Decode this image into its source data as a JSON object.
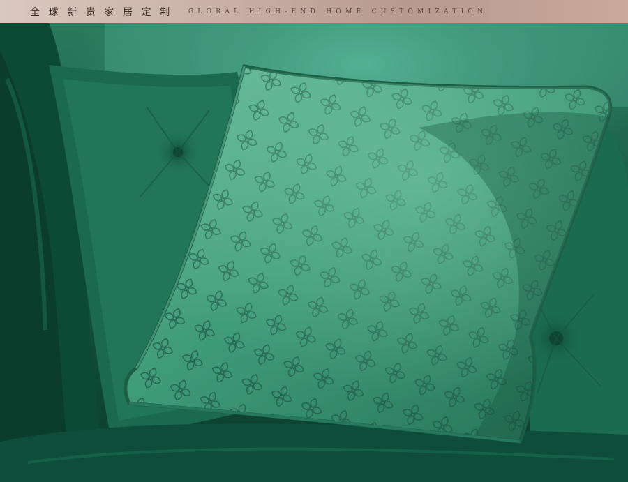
{
  "banner": {
    "title_cn": "全球新贵家居定制",
    "title_en": "GLORAL HIGH-END HOME CUSTOMIZATION"
  },
  "photo": {
    "subject": "green-velvet-cushion-on-tufted-sofa"
  },
  "colors": {
    "banner_light": "#d9c8c0",
    "banner_dark": "#b69a8f",
    "velvet_light": "#5fae90",
    "velvet_mid": "#2f8567",
    "velvet_dark": "#0b3d2c",
    "pattern": "#1e5a47"
  }
}
